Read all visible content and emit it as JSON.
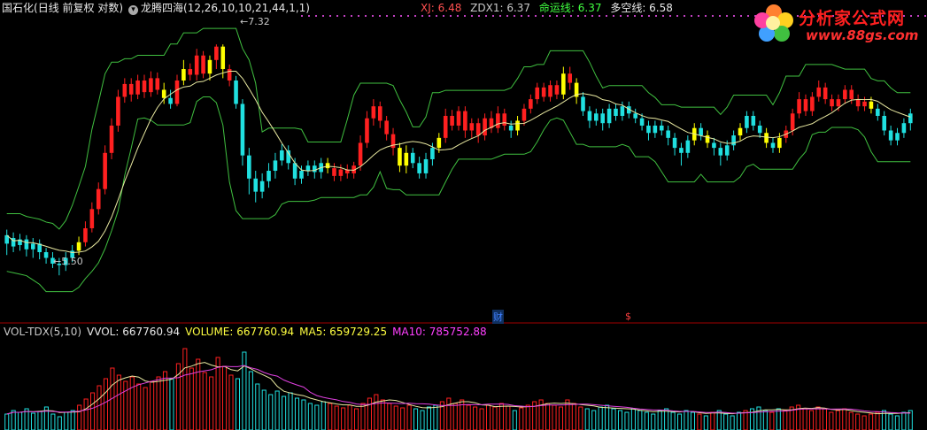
{
  "header": {
    "stock_name": "国石化",
    "period_info": "(日线 前复权 对数)",
    "indicator_name": "龙腾四海",
    "indicator_params": "(12,26,10,10,21,44,1,1)"
  },
  "indicator_values": [
    {
      "label": "XJ: 6.48",
      "color": "#ff4040"
    },
    {
      "label": "ZDX1: 6.37",
      "color": "#c8c8c8"
    },
    {
      "label": "命运线: 6.37",
      "color": "#40ff40"
    },
    {
      "label": "多空线: 6.58",
      "color": "#e8e8e8"
    }
  ],
  "volume_header": {
    "name": "VOL-TDX(5,10)",
    "vvol": "VVOL: 667760.94",
    "volume": "VOLUME: 667760.94",
    "ma5": "MA5: 659729.25",
    "ma10": "MA10: 785752.88"
  },
  "markers": {
    "high_label": "7.32",
    "low_label": "5.50",
    "finance_label": "财",
    "event_label": "$"
  },
  "logo": {
    "title": "分析家公式网",
    "url": "www.88gs.com"
  },
  "chart_data": {
    "type": "candlestick",
    "price_range": [
      5.3,
      7.5
    ],
    "price_scale": "log",
    "high_value": 7.32,
    "low_value": 5.5,
    "candles": [
      {
        "o": 5.72,
        "c": 5.78,
        "h": 5.82,
        "l": 5.64,
        "color": "cyan"
      },
      {
        "o": 5.76,
        "c": 5.7,
        "h": 5.8,
        "l": 5.66,
        "color": "cyan"
      },
      {
        "o": 5.71,
        "c": 5.75,
        "h": 5.79,
        "l": 5.67,
        "color": "cyan"
      },
      {
        "o": 5.75,
        "c": 5.68,
        "h": 5.78,
        "l": 5.63,
        "color": "cyan"
      },
      {
        "o": 5.68,
        "c": 5.72,
        "h": 5.76,
        "l": 5.62,
        "color": "cyan"
      },
      {
        "o": 5.72,
        "c": 5.66,
        "h": 5.75,
        "l": 5.61,
        "color": "cyan"
      },
      {
        "o": 5.66,
        "c": 5.62,
        "h": 5.69,
        "l": 5.58,
        "color": "cyan"
      },
      {
        "o": 5.62,
        "c": 5.58,
        "h": 5.66,
        "l": 5.55,
        "color": "cyan"
      },
      {
        "o": 5.58,
        "c": 5.57,
        "h": 5.62,
        "l": 5.5,
        "color": "cyan"
      },
      {
        "o": 5.57,
        "c": 5.62,
        "h": 5.66,
        "l": 5.53,
        "color": "cyan"
      },
      {
        "o": 5.62,
        "c": 5.67,
        "h": 5.71,
        "l": 5.59,
        "color": "cyan"
      },
      {
        "o": 5.67,
        "c": 5.73,
        "h": 5.77,
        "l": 5.64,
        "color": "yellow"
      },
      {
        "o": 5.73,
        "c": 5.83,
        "h": 5.88,
        "l": 5.7,
        "color": "red"
      },
      {
        "o": 5.83,
        "c": 5.97,
        "h": 6.02,
        "l": 5.8,
        "color": "red"
      },
      {
        "o": 5.97,
        "c": 6.12,
        "h": 6.17,
        "l": 5.93,
        "color": "red"
      },
      {
        "o": 6.12,
        "c": 6.4,
        "h": 6.46,
        "l": 6.08,
        "color": "red"
      },
      {
        "o": 6.4,
        "c": 6.62,
        "h": 6.68,
        "l": 6.35,
        "color": "red"
      },
      {
        "o": 6.62,
        "c": 6.86,
        "h": 6.92,
        "l": 6.57,
        "color": "red"
      },
      {
        "o": 6.86,
        "c": 6.97,
        "h": 7.02,
        "l": 6.81,
        "color": "red"
      },
      {
        "o": 6.97,
        "c": 6.88,
        "h": 7.02,
        "l": 6.82,
        "color": "red"
      },
      {
        "o": 6.88,
        "c": 7.0,
        "h": 7.05,
        "l": 6.84,
        "color": "red"
      },
      {
        "o": 7.0,
        "c": 6.9,
        "h": 7.05,
        "l": 6.85,
        "color": "red"
      },
      {
        "o": 6.9,
        "c": 7.02,
        "h": 7.08,
        "l": 6.86,
        "color": "red"
      },
      {
        "o": 7.02,
        "c": 6.92,
        "h": 7.07,
        "l": 6.88,
        "color": "red"
      },
      {
        "o": 6.92,
        "c": 6.85,
        "h": 6.98,
        "l": 6.8,
        "color": "yellow"
      },
      {
        "o": 6.85,
        "c": 6.8,
        "h": 6.92,
        "l": 6.76,
        "color": "cyan"
      },
      {
        "o": 6.8,
        "c": 7.0,
        "h": 7.05,
        "l": 6.78,
        "color": "red"
      },
      {
        "o": 7.0,
        "c": 7.1,
        "h": 7.18,
        "l": 6.96,
        "color": "yellow"
      },
      {
        "o": 7.1,
        "c": 7.05,
        "h": 7.15,
        "l": 7.0,
        "color": "red"
      },
      {
        "o": 7.05,
        "c": 7.22,
        "h": 7.28,
        "l": 7.0,
        "color": "red"
      },
      {
        "o": 7.22,
        "c": 7.06,
        "h": 7.26,
        "l": 7.02,
        "color": "red"
      },
      {
        "o": 7.06,
        "c": 7.18,
        "h": 7.22,
        "l": 7.0,
        "color": "yellow"
      },
      {
        "o": 7.18,
        "c": 7.3,
        "h": 7.32,
        "l": 7.1,
        "color": "red"
      },
      {
        "o": 7.3,
        "c": 7.1,
        "h": 7.32,
        "l": 7.02,
        "color": "yellow"
      },
      {
        "o": 7.1,
        "c": 7.0,
        "h": 7.14,
        "l": 6.95,
        "color": "red"
      },
      {
        "o": 7.0,
        "c": 6.8,
        "h": 7.04,
        "l": 6.76,
        "color": "cyan"
      },
      {
        "o": 6.8,
        "c": 6.38,
        "h": 6.84,
        "l": 6.3,
        "color": "cyan"
      },
      {
        "o": 6.38,
        "c": 6.2,
        "h": 6.44,
        "l": 6.08,
        "color": "cyan"
      },
      {
        "o": 6.2,
        "c": 6.1,
        "h": 6.26,
        "l": 6.02,
        "color": "cyan"
      },
      {
        "o": 6.1,
        "c": 6.18,
        "h": 6.24,
        "l": 6.05,
        "color": "cyan"
      },
      {
        "o": 6.18,
        "c": 6.26,
        "h": 6.32,
        "l": 6.13,
        "color": "cyan"
      },
      {
        "o": 6.26,
        "c": 6.34,
        "h": 6.4,
        "l": 6.2,
        "color": "cyan"
      },
      {
        "o": 6.34,
        "c": 6.42,
        "h": 6.47,
        "l": 6.3,
        "color": "cyan"
      },
      {
        "o": 6.42,
        "c": 6.32,
        "h": 6.46,
        "l": 6.27,
        "color": "cyan"
      },
      {
        "o": 6.32,
        "c": 6.2,
        "h": 6.36,
        "l": 6.15,
        "color": "cyan"
      },
      {
        "o": 6.2,
        "c": 6.26,
        "h": 6.3,
        "l": 6.16,
        "color": "cyan"
      },
      {
        "o": 6.26,
        "c": 6.3,
        "h": 6.34,
        "l": 6.22,
        "color": "cyan"
      },
      {
        "o": 6.3,
        "c": 6.25,
        "h": 6.34,
        "l": 6.2,
        "color": "cyan"
      },
      {
        "o": 6.25,
        "c": 6.32,
        "h": 6.36,
        "l": 6.2,
        "color": "cyan"
      },
      {
        "o": 6.32,
        "c": 6.28,
        "h": 6.36,
        "l": 6.24,
        "color": "yellow"
      },
      {
        "o": 6.28,
        "c": 6.22,
        "h": 6.32,
        "l": 6.18,
        "color": "red"
      },
      {
        "o": 6.22,
        "c": 6.27,
        "h": 6.31,
        "l": 6.18,
        "color": "red"
      },
      {
        "o": 6.27,
        "c": 6.24,
        "h": 6.31,
        "l": 6.2,
        "color": "red"
      },
      {
        "o": 6.24,
        "c": 6.3,
        "h": 6.33,
        "l": 6.2,
        "color": "red"
      },
      {
        "o": 6.3,
        "c": 6.48,
        "h": 6.54,
        "l": 6.26,
        "color": "red"
      },
      {
        "o": 6.48,
        "c": 6.68,
        "h": 6.74,
        "l": 6.44,
        "color": "red"
      },
      {
        "o": 6.68,
        "c": 6.78,
        "h": 6.84,
        "l": 6.62,
        "color": "red"
      },
      {
        "o": 6.78,
        "c": 6.66,
        "h": 6.82,
        "l": 6.6,
        "color": "red"
      },
      {
        "o": 6.66,
        "c": 6.55,
        "h": 6.7,
        "l": 6.5,
        "color": "red"
      },
      {
        "o": 6.55,
        "c": 6.44,
        "h": 6.6,
        "l": 6.38,
        "color": "red"
      },
      {
        "o": 6.44,
        "c": 6.3,
        "h": 6.48,
        "l": 6.25,
        "color": "yellow"
      },
      {
        "o": 6.3,
        "c": 6.4,
        "h": 6.46,
        "l": 6.24,
        "color": "yellow"
      },
      {
        "o": 6.4,
        "c": 6.32,
        "h": 6.44,
        "l": 6.28,
        "color": "cyan"
      },
      {
        "o": 6.32,
        "c": 6.24,
        "h": 6.37,
        "l": 6.2,
        "color": "cyan"
      },
      {
        "o": 6.24,
        "c": 6.35,
        "h": 6.4,
        "l": 6.2,
        "color": "cyan"
      },
      {
        "o": 6.35,
        "c": 6.44,
        "h": 6.48,
        "l": 6.3,
        "color": "cyan"
      },
      {
        "o": 6.44,
        "c": 6.52,
        "h": 6.56,
        "l": 6.4,
        "color": "yellow"
      },
      {
        "o": 6.52,
        "c": 6.7,
        "h": 6.76,
        "l": 6.48,
        "color": "red"
      },
      {
        "o": 6.7,
        "c": 6.62,
        "h": 6.75,
        "l": 6.58,
        "color": "red"
      },
      {
        "o": 6.62,
        "c": 6.74,
        "h": 6.78,
        "l": 6.58,
        "color": "red"
      },
      {
        "o": 6.74,
        "c": 6.58,
        "h": 6.78,
        "l": 6.52,
        "color": "red"
      },
      {
        "o": 6.58,
        "c": 6.64,
        "h": 6.68,
        "l": 6.52,
        "color": "red"
      },
      {
        "o": 6.64,
        "c": 6.54,
        "h": 6.68,
        "l": 6.48,
        "color": "red"
      },
      {
        "o": 6.54,
        "c": 6.68,
        "h": 6.72,
        "l": 6.5,
        "color": "red"
      },
      {
        "o": 6.68,
        "c": 6.6,
        "h": 6.74,
        "l": 6.56,
        "color": "red"
      },
      {
        "o": 6.6,
        "c": 6.72,
        "h": 6.78,
        "l": 6.56,
        "color": "red"
      },
      {
        "o": 6.72,
        "c": 6.62,
        "h": 6.76,
        "l": 6.58,
        "color": "red"
      },
      {
        "o": 6.62,
        "c": 6.58,
        "h": 6.66,
        "l": 6.52,
        "color": "cyan"
      },
      {
        "o": 6.58,
        "c": 6.66,
        "h": 6.7,
        "l": 6.54,
        "color": "yellow"
      },
      {
        "o": 6.66,
        "c": 6.76,
        "h": 6.8,
        "l": 6.62,
        "color": "red"
      },
      {
        "o": 6.76,
        "c": 6.84,
        "h": 6.88,
        "l": 6.72,
        "color": "red"
      },
      {
        "o": 6.84,
        "c": 6.94,
        "h": 6.98,
        "l": 6.8,
        "color": "red"
      },
      {
        "o": 6.94,
        "c": 6.86,
        "h": 6.98,
        "l": 6.82,
        "color": "red"
      },
      {
        "o": 6.86,
        "c": 6.96,
        "h": 7.0,
        "l": 6.82,
        "color": "red"
      },
      {
        "o": 6.96,
        "c": 6.88,
        "h": 7.0,
        "l": 6.84,
        "color": "red"
      },
      {
        "o": 6.88,
        "c": 7.06,
        "h": 7.12,
        "l": 6.84,
        "color": "yellow"
      },
      {
        "o": 7.06,
        "c": 6.98,
        "h": 7.12,
        "l": 6.92,
        "color": "red"
      },
      {
        "o": 6.98,
        "c": 6.86,
        "h": 7.02,
        "l": 6.8,
        "color": "yellow"
      },
      {
        "o": 6.86,
        "c": 6.74,
        "h": 6.9,
        "l": 6.7,
        "color": "cyan"
      },
      {
        "o": 6.74,
        "c": 6.66,
        "h": 6.78,
        "l": 6.6,
        "color": "cyan"
      },
      {
        "o": 6.66,
        "c": 6.72,
        "h": 6.76,
        "l": 6.62,
        "color": "cyan"
      },
      {
        "o": 6.72,
        "c": 6.64,
        "h": 6.76,
        "l": 6.58,
        "color": "cyan"
      },
      {
        "o": 6.64,
        "c": 6.76,
        "h": 6.8,
        "l": 6.6,
        "color": "cyan"
      },
      {
        "o": 6.76,
        "c": 6.7,
        "h": 6.8,
        "l": 6.66,
        "color": "cyan"
      },
      {
        "o": 6.7,
        "c": 6.78,
        "h": 6.82,
        "l": 6.66,
        "color": "cyan"
      },
      {
        "o": 6.78,
        "c": 6.72,
        "h": 6.82,
        "l": 6.68,
        "color": "cyan"
      },
      {
        "o": 6.72,
        "c": 6.68,
        "h": 6.76,
        "l": 6.64,
        "color": "cyan"
      },
      {
        "o": 6.68,
        "c": 6.62,
        "h": 6.72,
        "l": 6.58,
        "color": "cyan"
      },
      {
        "o": 6.62,
        "c": 6.56,
        "h": 6.66,
        "l": 6.5,
        "color": "cyan"
      },
      {
        "o": 6.56,
        "c": 6.62,
        "h": 6.66,
        "l": 6.52,
        "color": "cyan"
      },
      {
        "o": 6.62,
        "c": 6.58,
        "h": 6.66,
        "l": 6.54,
        "color": "cyan"
      },
      {
        "o": 6.58,
        "c": 6.52,
        "h": 6.62,
        "l": 6.46,
        "color": "cyan"
      },
      {
        "o": 6.52,
        "c": 6.44,
        "h": 6.56,
        "l": 6.38,
        "color": "cyan"
      },
      {
        "o": 6.44,
        "c": 6.4,
        "h": 6.48,
        "l": 6.3,
        "color": "cyan"
      },
      {
        "o": 6.4,
        "c": 6.5,
        "h": 6.54,
        "l": 6.36,
        "color": "cyan"
      },
      {
        "o": 6.5,
        "c": 6.6,
        "h": 6.64,
        "l": 6.46,
        "color": "yellow"
      },
      {
        "o": 6.6,
        "c": 6.54,
        "h": 6.64,
        "l": 6.5,
        "color": "cyan"
      },
      {
        "o": 6.54,
        "c": 6.48,
        "h": 6.58,
        "l": 6.44,
        "color": "yellow"
      },
      {
        "o": 6.48,
        "c": 6.44,
        "h": 6.52,
        "l": 6.38,
        "color": "cyan"
      },
      {
        "o": 6.44,
        "c": 6.38,
        "h": 6.48,
        "l": 6.3,
        "color": "cyan"
      },
      {
        "o": 6.38,
        "c": 6.46,
        "h": 6.5,
        "l": 6.34,
        "color": "cyan"
      },
      {
        "o": 6.46,
        "c": 6.54,
        "h": 6.58,
        "l": 6.42,
        "color": "cyan"
      },
      {
        "o": 6.54,
        "c": 6.6,
        "h": 6.64,
        "l": 6.5,
        "color": "yellow"
      },
      {
        "o": 6.6,
        "c": 6.7,
        "h": 6.74,
        "l": 6.56,
        "color": "cyan"
      },
      {
        "o": 6.7,
        "c": 6.62,
        "h": 6.74,
        "l": 6.58,
        "color": "cyan"
      },
      {
        "o": 6.62,
        "c": 6.56,
        "h": 6.66,
        "l": 6.52,
        "color": "cyan"
      },
      {
        "o": 6.56,
        "c": 6.48,
        "h": 6.6,
        "l": 6.44,
        "color": "yellow"
      },
      {
        "o": 6.48,
        "c": 6.44,
        "h": 6.52,
        "l": 6.4,
        "color": "cyan"
      },
      {
        "o": 6.44,
        "c": 6.52,
        "h": 6.56,
        "l": 6.4,
        "color": "yellow"
      },
      {
        "o": 6.52,
        "c": 6.58,
        "h": 6.62,
        "l": 6.48,
        "color": "red"
      },
      {
        "o": 6.58,
        "c": 6.72,
        "h": 6.76,
        "l": 6.54,
        "color": "red"
      },
      {
        "o": 6.72,
        "c": 6.84,
        "h": 6.9,
        "l": 6.68,
        "color": "red"
      },
      {
        "o": 6.84,
        "c": 6.74,
        "h": 6.88,
        "l": 6.7,
        "color": "red"
      },
      {
        "o": 6.74,
        "c": 6.86,
        "h": 6.9,
        "l": 6.7,
        "color": "red"
      },
      {
        "o": 6.86,
        "c": 6.94,
        "h": 7.0,
        "l": 6.82,
        "color": "red"
      },
      {
        "o": 6.94,
        "c": 6.84,
        "h": 6.98,
        "l": 6.8,
        "color": "red"
      },
      {
        "o": 6.84,
        "c": 6.78,
        "h": 6.88,
        "l": 6.74,
        "color": "red"
      },
      {
        "o": 6.78,
        "c": 6.84,
        "h": 6.88,
        "l": 6.74,
        "color": "red"
      },
      {
        "o": 6.84,
        "c": 6.92,
        "h": 6.96,
        "l": 6.8,
        "color": "red"
      },
      {
        "o": 6.92,
        "c": 6.84,
        "h": 6.96,
        "l": 6.8,
        "color": "red"
      },
      {
        "o": 6.84,
        "c": 6.78,
        "h": 6.88,
        "l": 6.74,
        "color": "red"
      },
      {
        "o": 6.78,
        "c": 6.82,
        "h": 6.86,
        "l": 6.74,
        "color": "red"
      },
      {
        "o": 6.82,
        "c": 6.76,
        "h": 6.86,
        "l": 6.72,
        "color": "yellow"
      },
      {
        "o": 6.76,
        "c": 6.7,
        "h": 6.8,
        "l": 6.66,
        "color": "cyan"
      },
      {
        "o": 6.7,
        "c": 6.58,
        "h": 6.74,
        "l": 6.54,
        "color": "cyan"
      },
      {
        "o": 6.58,
        "c": 6.5,
        "h": 6.62,
        "l": 6.46,
        "color": "cyan"
      },
      {
        "o": 6.5,
        "c": 6.56,
        "h": 6.6,
        "l": 6.46,
        "color": "cyan"
      },
      {
        "o": 6.56,
        "c": 6.64,
        "h": 6.68,
        "l": 6.52,
        "color": "cyan"
      },
      {
        "o": 6.64,
        "c": 6.72,
        "h": 6.76,
        "l": 6.58,
        "color": "cyan"
      }
    ],
    "volume": {
      "series_names": [
        "VOLUME",
        "MA5",
        "MA10"
      ],
      "bars": [
        0.18,
        0.22,
        0.2,
        0.24,
        0.19,
        0.21,
        0.26,
        0.18,
        0.15,
        0.2,
        0.22,
        0.28,
        0.35,
        0.42,
        0.5,
        0.58,
        0.7,
        0.62,
        0.55,
        0.6,
        0.52,
        0.48,
        0.55,
        0.6,
        0.66,
        0.58,
        0.75,
        0.92,
        0.7,
        0.8,
        0.65,
        0.6,
        0.82,
        0.72,
        0.62,
        0.58,
        0.88,
        0.66,
        0.52,
        0.45,
        0.4,
        0.44,
        0.38,
        0.42,
        0.36,
        0.34,
        0.3,
        0.28,
        0.32,
        0.3,
        0.27,
        0.25,
        0.28,
        0.24,
        0.3,
        0.36,
        0.4,
        0.34,
        0.3,
        0.27,
        0.25,
        0.28,
        0.24,
        0.22,
        0.26,
        0.28,
        0.32,
        0.36,
        0.3,
        0.34,
        0.28,
        0.26,
        0.24,
        0.28,
        0.26,
        0.3,
        0.27,
        0.22,
        0.25,
        0.28,
        0.32,
        0.34,
        0.3,
        0.28,
        0.26,
        0.34,
        0.3,
        0.26,
        0.24,
        0.22,
        0.26,
        0.28,
        0.24,
        0.22,
        0.2,
        0.24,
        0.22,
        0.2,
        0.18,
        0.22,
        0.24,
        0.2,
        0.18,
        0.22,
        0.2,
        0.18,
        0.16,
        0.2,
        0.22,
        0.18,
        0.16,
        0.2,
        0.22,
        0.24,
        0.26,
        0.22,
        0.2,
        0.24,
        0.22,
        0.26,
        0.28,
        0.24,
        0.22,
        0.26,
        0.24,
        0.2,
        0.22,
        0.24,
        0.2,
        0.18,
        0.16,
        0.18,
        0.2,
        0.22,
        0.18,
        0.16,
        0.2,
        0.22
      ]
    }
  },
  "colors": {
    "background": "#000000",
    "up_candle": "#ff2020",
    "down_candle": "#20e0e0",
    "signal_candle": "#ffff00",
    "ma_line": "#e8e8a0",
    "band_line": "#40c040",
    "vol_ma5": "#e8e8a0",
    "vol_ma10": "#e040e0",
    "divider": "#c00000"
  }
}
